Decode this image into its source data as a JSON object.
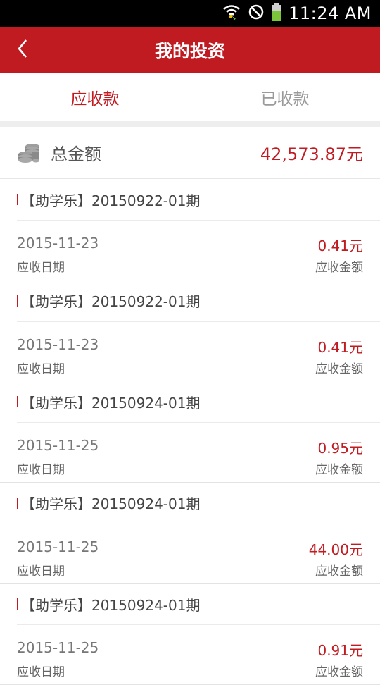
{
  "status_bar": {
    "time": "11:24 AM"
  },
  "header": {
    "title": "我的投资"
  },
  "tabs": [
    {
      "label": "应收款",
      "active": true
    },
    {
      "label": "已收款",
      "active": false
    }
  ],
  "summary": {
    "label": "总金额",
    "amount": "42,573.87元"
  },
  "items": [
    {
      "name": "【助学乐】20150922-01期",
      "date": "2015-11-23",
      "date_label": "应收日期",
      "amount": "0.41元",
      "amount_label": "应收金额"
    },
    {
      "name": "【助学乐】20150922-01期",
      "date": "2015-11-23",
      "date_label": "应收日期",
      "amount": "0.41元",
      "amount_label": "应收金额"
    },
    {
      "name": "【助学乐】20150924-01期",
      "date": "2015-11-25",
      "date_label": "应收日期",
      "amount": "0.95元",
      "amount_label": "应收金额"
    },
    {
      "name": "【助学乐】20150924-01期",
      "date": "2015-11-25",
      "date_label": "应收日期",
      "amount": "44.00元",
      "amount_label": "应收金额"
    },
    {
      "name": "【助学乐】20150924-01期",
      "date": "2015-11-25",
      "date_label": "应收日期",
      "amount": "0.91元",
      "amount_label": "应收金额"
    }
  ],
  "colors": {
    "accent": "#c11b22",
    "status_bar": "#000000"
  }
}
